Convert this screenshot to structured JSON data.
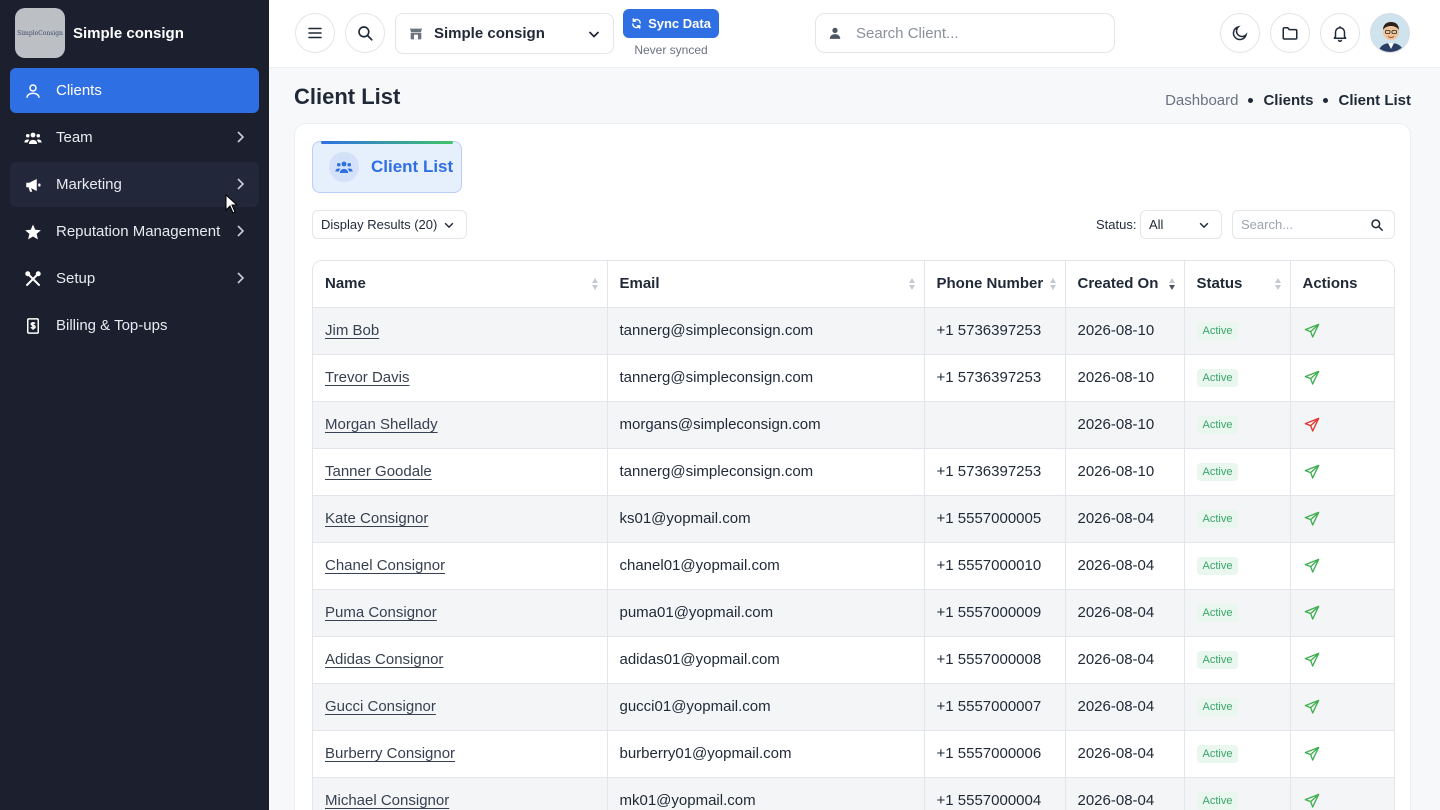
{
  "brand": {
    "name": "Simple consign",
    "logo_text": "SimpleConsign"
  },
  "sidebar": {
    "items": [
      {
        "label": "Clients",
        "icon": "user-icon"
      },
      {
        "label": "Team",
        "icon": "users-icon"
      },
      {
        "label": "Marketing",
        "icon": "megaphone-icon"
      },
      {
        "label": "Reputation Management",
        "icon": "star-icon"
      },
      {
        "label": "Setup",
        "icon": "tools-icon"
      },
      {
        "label": "Billing & Top-ups",
        "icon": "receipt-icon"
      }
    ],
    "active_item": "Clients"
  },
  "topbar": {
    "store_select": "Simple consign",
    "sync_button": "Sync Data",
    "sync_status": "Never synced",
    "search_placeholder": "Search Client..."
  },
  "page": {
    "title": "Client List",
    "breadcrumb": [
      "Dashboard",
      "Clients",
      "Client List"
    ]
  },
  "tab": {
    "label": "Client List"
  },
  "controls": {
    "display_results": "Display Results (20)",
    "status_label": "Status:",
    "status_value": "All",
    "search_placeholder": "Search..."
  },
  "table": {
    "columns": [
      "Name",
      "Email",
      "Phone Number",
      "Created On",
      "Status",
      "Actions"
    ],
    "rows": [
      {
        "name": "Jim Bob",
        "email": "tannerg@simpleconsign.com",
        "phone": "+1 5736397253",
        "created": "2026-08-10",
        "status": "Active",
        "action_color": "green"
      },
      {
        "name": "Trevor Davis",
        "email": "tannerg@simpleconsign.com",
        "phone": "+1 5736397253",
        "created": "2026-08-10",
        "status": "Active",
        "action_color": "green"
      },
      {
        "name": "Morgan Shellady",
        "email": "morgans@simpleconsign.com",
        "phone": "",
        "created": "2026-08-10",
        "status": "Active",
        "action_color": "red"
      },
      {
        "name": "Tanner Goodale",
        "email": "tannerg@simpleconsign.com",
        "phone": "+1 5736397253",
        "created": "2026-08-10",
        "status": "Active",
        "action_color": "green"
      },
      {
        "name": "Kate Consignor",
        "email": "ks01@yopmail.com",
        "phone": "+1 5557000005",
        "created": "2026-08-04",
        "status": "Active",
        "action_color": "green"
      },
      {
        "name": "Chanel Consignor",
        "email": "chanel01@yopmail.com",
        "phone": "+1 5557000010",
        "created": "2026-08-04",
        "status": "Active",
        "action_color": "green"
      },
      {
        "name": "Puma Consignor",
        "email": "puma01@yopmail.com",
        "phone": "+1 5557000009",
        "created": "2026-08-04",
        "status": "Active",
        "action_color": "green"
      },
      {
        "name": "Adidas Consignor",
        "email": "adidas01@yopmail.com",
        "phone": "+1 5557000008",
        "created": "2026-08-04",
        "status": "Active",
        "action_color": "green"
      },
      {
        "name": "Gucci Consignor",
        "email": "gucci01@yopmail.com",
        "phone": "+1 5557000007",
        "created": "2026-08-04",
        "status": "Active",
        "action_color": "green"
      },
      {
        "name": "Burberry Consignor",
        "email": "burberry01@yopmail.com",
        "phone": "+1 5557000006",
        "created": "2026-08-04",
        "status": "Active",
        "action_color": "green"
      },
      {
        "name": "Michael Consignor",
        "email": "mk01@yopmail.com",
        "phone": "+1 5557000004",
        "created": "2026-08-04",
        "status": "Active",
        "action_color": "green"
      }
    ]
  },
  "colors": {
    "accent": "#2f6fe4",
    "sidebar_bg": "#1b1f2e",
    "status_green": "#3aa46a",
    "send_green": "#3fae4f",
    "send_red": "#e0342c"
  }
}
